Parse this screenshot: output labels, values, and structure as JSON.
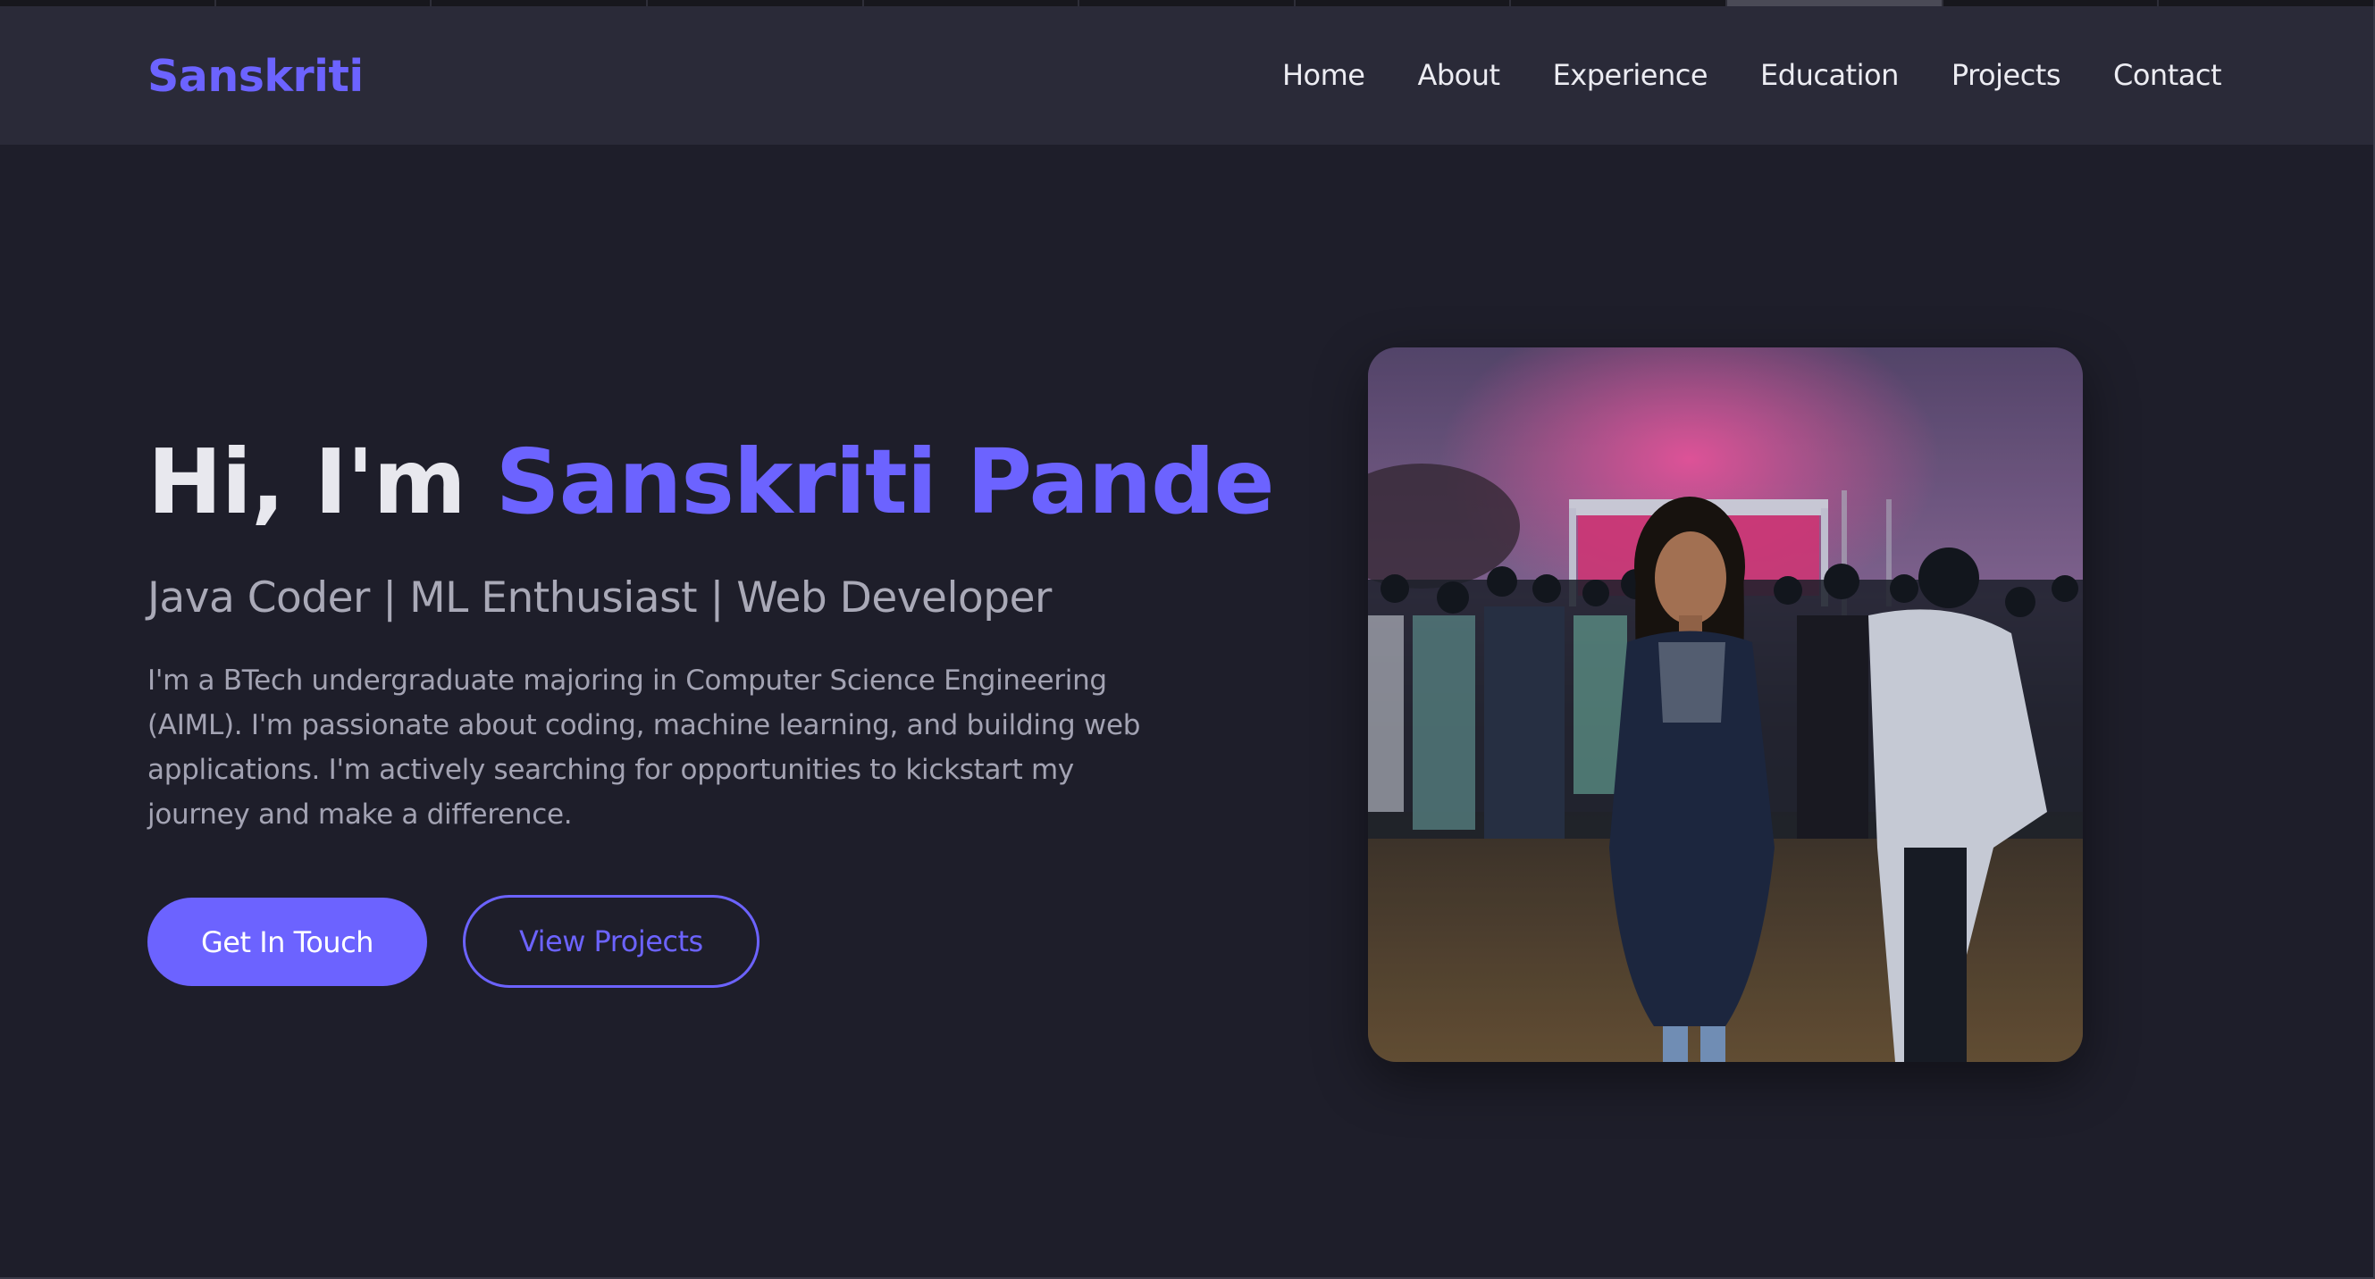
{
  "navbar": {
    "brand": "Sanskriti",
    "links": [
      "Home",
      "About",
      "Experience",
      "Education",
      "Projects",
      "Contact"
    ]
  },
  "hero": {
    "greeting": "Hi, I'm",
    "name": "Sanskriti Pande",
    "subtitle": "Java Coder | ML Enthusiast | Web Developer",
    "description": "I'm a BTech undergraduate majoring in Computer Science Engineering (AIML). I'm passionate about coding, machine learning, and building web applications. I'm actively searching for opportunities to kickstart my journey and make a difference.",
    "primary_button": "Get In Touch",
    "secondary_button": "View Projects"
  },
  "colors": {
    "accent": "#6c63ff",
    "background": "#1e1e2a",
    "navbar": "#2a2a38"
  }
}
